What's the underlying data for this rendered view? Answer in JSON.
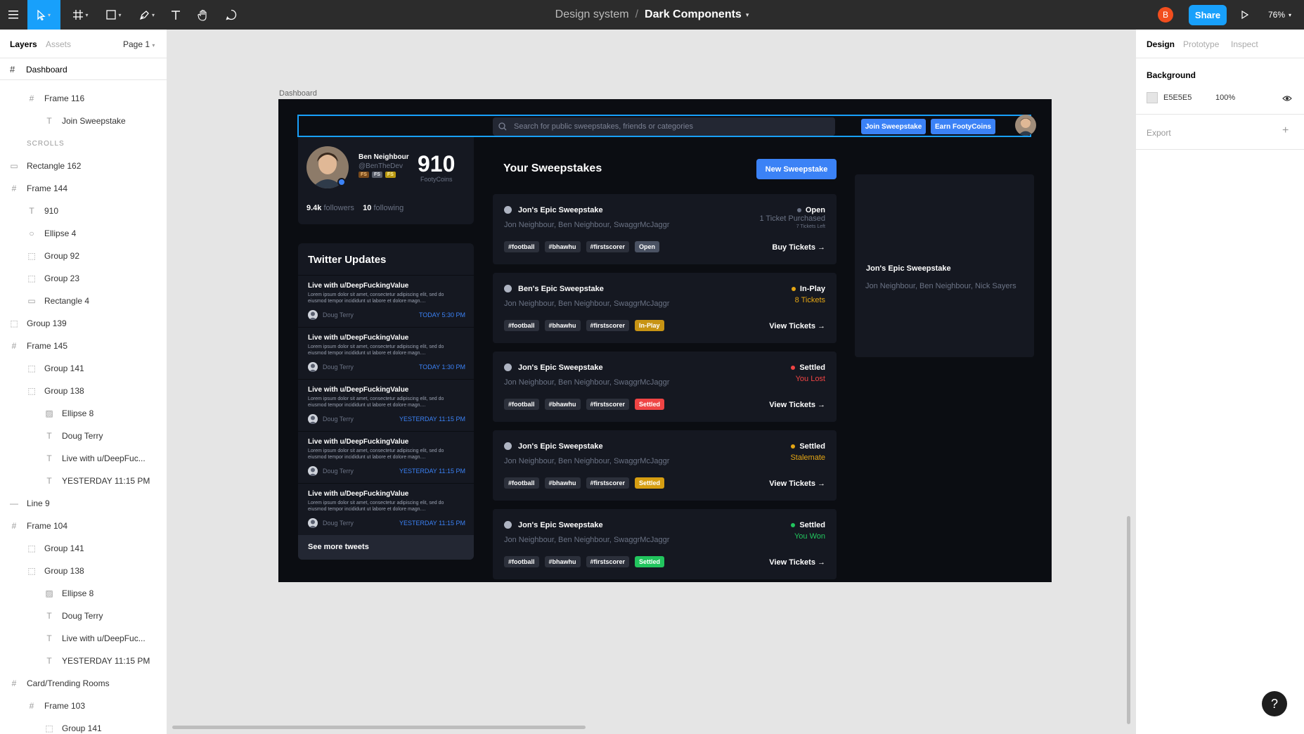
{
  "toolbar": {
    "breadcrumb": "Design system",
    "separator": "/",
    "file_name": "Dark Components",
    "avatar_letter": "B",
    "share_label": "Share",
    "zoom": "76%"
  },
  "left_panel": {
    "tabs": [
      "Layers",
      "Assets"
    ],
    "page": "Page 1",
    "root": "Dashboard",
    "layers": [
      {
        "label": "Frame 116",
        "icon": "frame",
        "indent": 2
      },
      {
        "label": "Join Sweepstake",
        "icon": "text",
        "indent": 3
      },
      {
        "label": "SCROLLS",
        "icon": "section",
        "indent": 1
      },
      {
        "label": "Rectangle 162",
        "icon": "rect",
        "indent": 1
      },
      {
        "label": "Frame 144",
        "icon": "frame",
        "indent": 1
      },
      {
        "label": "910",
        "icon": "text",
        "indent": 2
      },
      {
        "label": "Ellipse 4",
        "icon": "ellipse",
        "indent": 2
      },
      {
        "label": "Group 92",
        "icon": "group",
        "indent": 2
      },
      {
        "label": "Group 23",
        "icon": "group",
        "indent": 2
      },
      {
        "label": "Rectangle 4",
        "icon": "rect",
        "indent": 2
      },
      {
        "label": "Group 139",
        "icon": "group",
        "indent": 1
      },
      {
        "label": "Frame 145",
        "icon": "frame",
        "indent": 1
      },
      {
        "label": "Group 141",
        "icon": "group",
        "indent": 2
      },
      {
        "label": "Group 138",
        "icon": "group",
        "indent": 2
      },
      {
        "label": "Ellipse 8",
        "icon": "image",
        "indent": 3
      },
      {
        "label": "Doug Terry",
        "icon": "text",
        "indent": 3
      },
      {
        "label": "Live with u/DeepFuc...",
        "icon": "text",
        "indent": 3
      },
      {
        "label": "YESTERDAY 11:15 PM",
        "icon": "text",
        "indent": 3
      },
      {
        "label": "Line 9",
        "icon": "line",
        "indent": 1
      },
      {
        "label": "Frame 104",
        "icon": "frame",
        "indent": 1
      },
      {
        "label": "Group 141",
        "icon": "group",
        "indent": 2
      },
      {
        "label": "Group 138",
        "icon": "group",
        "indent": 2
      },
      {
        "label": "Ellipse 8",
        "icon": "image",
        "indent": 3
      },
      {
        "label": "Doug Terry",
        "icon": "text",
        "indent": 3
      },
      {
        "label": "Live with u/DeepFuc...",
        "icon": "text",
        "indent": 3
      },
      {
        "label": "YESTERDAY 11:15 PM",
        "icon": "text",
        "indent": 3
      },
      {
        "label": "Card/Trending Rooms",
        "icon": "frame",
        "indent": 1
      },
      {
        "label": "Frame 103",
        "icon": "frame",
        "indent": 2
      },
      {
        "label": "Group 141",
        "icon": "group",
        "indent": 3
      }
    ]
  },
  "right_panel": {
    "tabs": [
      "Design",
      "Prototype",
      "Inspect"
    ],
    "background_label": "Background",
    "background_hex": "E5E5E5",
    "background_opacity": "100%",
    "export_label": "Export"
  },
  "canvas": {
    "frame_label": "Dashboard"
  },
  "dashboard": {
    "search_placeholder": "Search for public sweepstakes, friends or categories",
    "join_label": "Join Sweepstake",
    "earn_label": "Earn FootyCoins",
    "profile": {
      "name": "Ben Neighbour",
      "handle": "@BenTheDev",
      "badges": [
        "FS",
        "FS",
        "FS"
      ],
      "coins": "910",
      "coins_label": "FootyCoins",
      "followers_count": "9.4k",
      "followers_label": "followers",
      "following_count": "10",
      "following_label": "following"
    },
    "twitter": {
      "title": "Twitter Updates",
      "tweets": [
        {
          "headline": "Live with u/DeepFuckingValue",
          "body": "Lorem ipsum dolor sit amet, consectetur adipiscing elit, sed do eiusmod tempor incididunt ut labore et dolore magn....",
          "author": "Doug Terry",
          "time": "TODAY 5:30 PM"
        },
        {
          "headline": "Live with u/DeepFuckingValue",
          "body": "Lorem ipsum dolor sit amet, consectetur adipiscing elit, sed do eiusmod tempor incididunt ut labore et dolore magn....",
          "author": "Doug Terry",
          "time": "TODAY 1:30 PM"
        },
        {
          "headline": "Live with u/DeepFuckingValue",
          "body": "Lorem ipsum dolor sit amet, consectetur adipiscing elit, sed do eiusmod tempor incididunt ut labore et dolore magn....",
          "author": "Doug Terry",
          "time": "YESTERDAY 11:15 PM"
        },
        {
          "headline": "Live with u/DeepFuckingValue",
          "body": "Lorem ipsum dolor sit amet, consectetur adipiscing elit, sed do eiusmod tempor incididunt ut labore et dolore magn....",
          "author": "Doug Terry",
          "time": "YESTERDAY 11:15 PM"
        },
        {
          "headline": "Live with u/DeepFuckingValue",
          "body": "Lorem ipsum dolor sit amet, consectetur adipiscing elit, sed do eiusmod tempor incididunt ut labore et dolore magn....",
          "author": "Doug Terry",
          "time": "YESTERDAY 11:15 PM"
        }
      ],
      "more_label": "See more tweets"
    },
    "sweepstakes": {
      "title": "Your Sweepstakes",
      "new_label": "New Sweepstake",
      "cards": [
        {
          "title": "Jon's Epic Sweepstake",
          "participants": "Jon Neighbour, Ben Neighbour, SwaggrMcJaggr",
          "tags": [
            "#football",
            "#bhawhu",
            "#firstscorer"
          ],
          "status": "Open",
          "status_color": "#6b7385",
          "tag_color": "#4a5263",
          "tag_text": "#ffffff",
          "sub": "1 Ticket Purchased",
          "sub_color": "#6b7385",
          "sub2": "7 Tickets Left",
          "action": "Buy Tickets →"
        },
        {
          "title": "Ben's Epic Sweepstake",
          "participants": "Jon Neighbour, Ben Neighbour, SwaggrMcJaggr",
          "tags": [
            "#football",
            "#bhawhu",
            "#firstscorer"
          ],
          "status": "In-Play",
          "status_color": "#e5a614",
          "tag_color": "#c79314",
          "tag_text": "#ffffff",
          "sub": "8 Tickets",
          "sub_color": "#e5a614",
          "sub2": "",
          "action": "View Tickets →"
        },
        {
          "title": "Jon's Epic Sweepstake",
          "participants": "Jon Neighbour, Ben Neighbour, SwaggrMcJaggr",
          "tags": [
            "#football",
            "#bhawhu",
            "#firstscorer"
          ],
          "status": "Settled",
          "status_color": "#ef4444",
          "tag_color": "#ef4444",
          "tag_text": "#ffffff",
          "sub": "You Lost",
          "sub_color": "#ef4444",
          "sub2": "",
          "action": "View Tickets →",
          "status_tag": "Settled"
        },
        {
          "title": "Jon's Epic Sweepstake",
          "participants": "Jon Neighbour, Ben Neighbour, SwaggrMcJaggr",
          "tags": [
            "#football",
            "#bhawhu",
            "#firstscorer"
          ],
          "status": "Settled",
          "status_color": "#e5a614",
          "tag_color": "#d69e12",
          "tag_text": "#ffffff",
          "sub": "Stalemate",
          "sub_color": "#e5a614",
          "sub2": "",
          "action": "View Tickets →",
          "status_tag": "Settled"
        },
        {
          "title": "Jon's Epic Sweepstake",
          "participants": "Jon Neighbour, Ben Neighbour, SwaggrMcJaggr",
          "tags": [
            "#football",
            "#bhawhu",
            "#firstscorer"
          ],
          "status": "Settled",
          "status_color": "#22c55e",
          "tag_color": "#22c55e",
          "tag_text": "#ffffff",
          "sub": "You Won",
          "sub_color": "#22c55e",
          "sub2": "",
          "action": "View Tickets →",
          "status_tag": "Settled"
        }
      ]
    },
    "side_card": {
      "title": "Jon's Epic Sweepstake",
      "participants": "Jon Neighbour, Ben Neighbour, Nick Sayers"
    }
  },
  "colors": {
    "accent": "#18a0fb",
    "toolbar_bg": "#2c2c2c",
    "canvas_bg": "#e5e5e5",
    "frame_bg": "#0b0d12",
    "card_bg": "#151821",
    "primary_button": "#3b82f6"
  }
}
